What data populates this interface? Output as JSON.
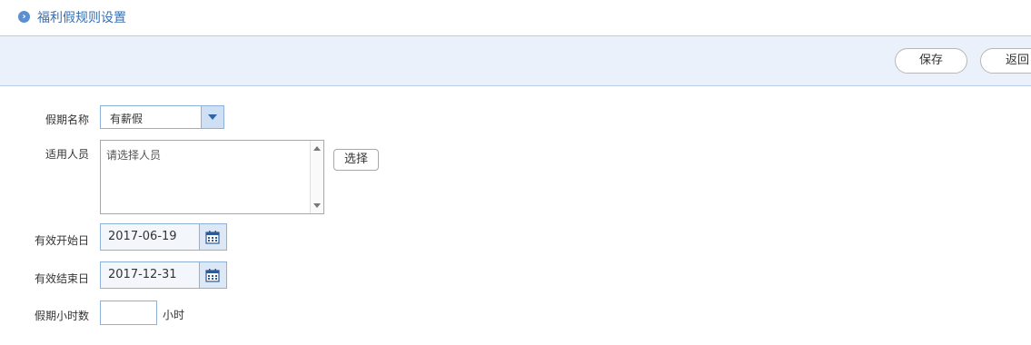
{
  "page": {
    "title": "福利假规则设置"
  },
  "toolbar": {
    "save_label": "保存",
    "back_label": "返回"
  },
  "form": {
    "leave_name": {
      "label": "假期名称",
      "value": "有薪假"
    },
    "applicable_staff": {
      "label": "适用人员",
      "placeholder": "请选择人员",
      "choose_label": "选择"
    },
    "start_date": {
      "label": "有效开始日",
      "value": "2017-06-19"
    },
    "end_date": {
      "label": "有效结束日",
      "value": "2017-12-31"
    },
    "leave_hours": {
      "label": "假期小时数",
      "value": "",
      "unit": "小时"
    }
  },
  "icons": {
    "title": "chevron-right-circle-icon",
    "dropdown": "caret-down-icon",
    "calendar": "calendar-icon"
  }
}
